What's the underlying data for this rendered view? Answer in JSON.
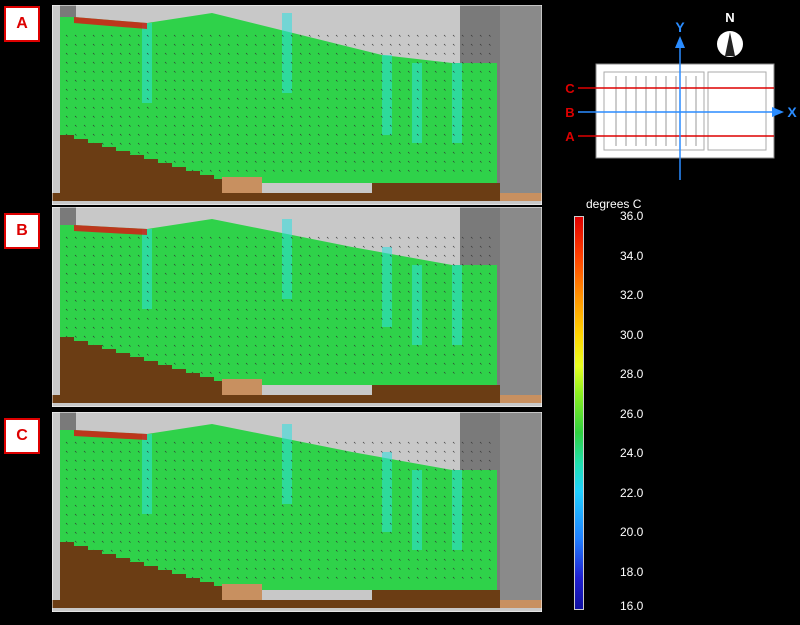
{
  "sections": [
    {
      "id": "A",
      "label": "A"
    },
    {
      "id": "B",
      "label": "B"
    },
    {
      "id": "C",
      "label": "C"
    }
  ],
  "keymap": {
    "north_label": "N",
    "y_axis_label": "Y",
    "x_axis_label": "X",
    "section_lines": [
      "C",
      "B",
      "A"
    ]
  },
  "colorbar": {
    "title": "degrees C",
    "ticks": [
      "36.0",
      "34.0",
      "32.0",
      "30.0",
      "28.0",
      "26.0",
      "24.0",
      "22.0",
      "20.0",
      "18.0",
      "16.0"
    ],
    "min": 16.0,
    "max": 36.0
  },
  "colors": {
    "background": "#000000",
    "building_gray": "#c8c8c8",
    "dark_gray": "#7a7a7a",
    "seating_brown": "#6b3d14",
    "floor_tan": "#c89060",
    "field_green": "#2fd24a",
    "cool_cyan": "#2ee0e0",
    "hot_red": "#e01010",
    "label_red": "#dd0000",
    "axis_blue": "#2a8cff"
  }
}
